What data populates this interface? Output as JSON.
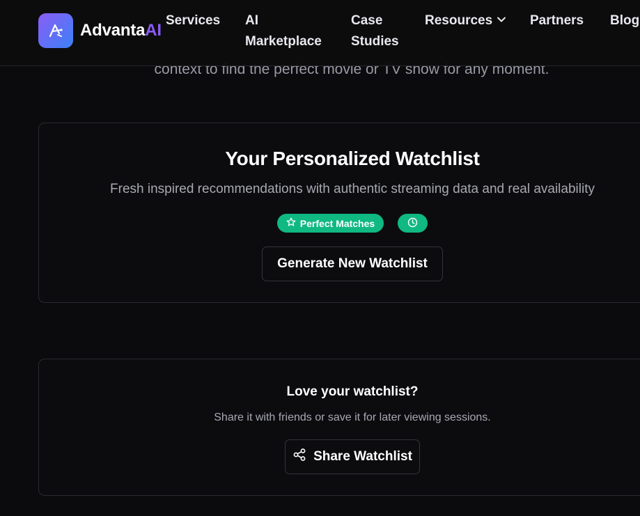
{
  "hero": {
    "line": "context to find the perfect movie or TV show for any moment."
  },
  "header": {
    "brand_main": "Advanta",
    "brand_accent": "AI",
    "nav": {
      "services": "Services",
      "ai_line1": "AI",
      "ai_line2": "Marketplace",
      "case_line1": "Case",
      "case_line2": "Studies",
      "resources": "Resources",
      "partners": "Partners",
      "blog": "Blog"
    }
  },
  "watchlist": {
    "title": "Your Personalized Watchlist",
    "subtitle": "Fresh inspired recommendations with authentic streaming data and real availability",
    "badge_matches": "Perfect Matches",
    "generate_label": "Generate New Watchlist"
  },
  "share": {
    "title": "Love your watchlist?",
    "subtitle": "Share it with friends or save it for later viewing sessions.",
    "button_label": "Share Watchlist"
  },
  "icons": {
    "logo": "logo-icon",
    "chevron": "chevron-down-icon",
    "star": "star-icon",
    "clock": "clock-icon",
    "share": "share-icon"
  },
  "colors": {
    "background": "#0b0b0d",
    "brand_gradient_start": "#8b5cf6",
    "brand_gradient_end": "#3b82f6",
    "brand_accent": "#8b5cf6",
    "badge": "#10b981",
    "card_border": "#2a2a30",
    "muted_text": "#a8a8b3"
  }
}
